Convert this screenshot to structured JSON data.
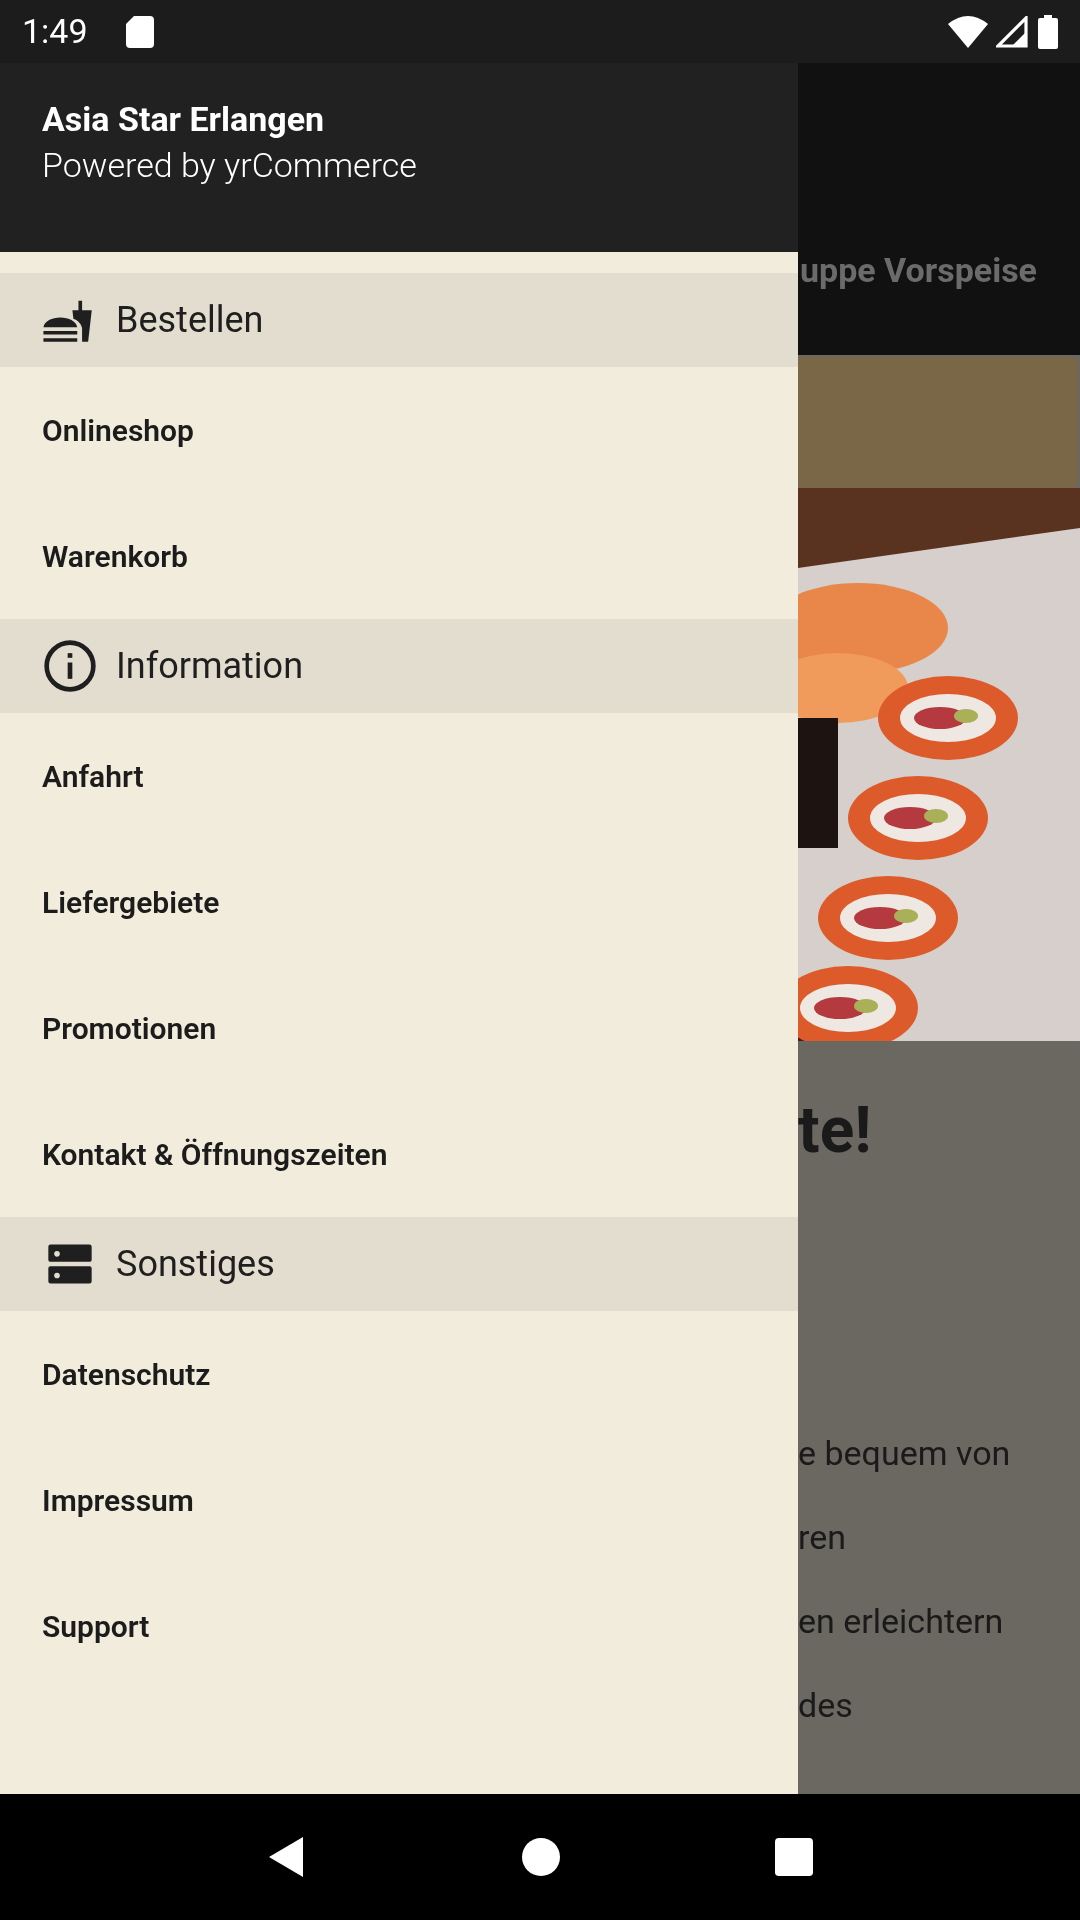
{
  "status_bar": {
    "time": "1:49"
  },
  "drawer": {
    "title": "Asia Star Erlangen",
    "subtitle": "Powered by yrCommerce",
    "sections": [
      {
        "label": "Bestellen",
        "items": [
          "Onlineshop",
          "Warenkorb"
        ]
      },
      {
        "label": "Information",
        "items": [
          "Anfahrt",
          "Liefergebiete",
          "Promotionen",
          "Kontakt & Öffnungszeiten"
        ]
      },
      {
        "label": "Sonstiges",
        "items": [
          "Datenschutz",
          "Impressum",
          "Support"
        ]
      }
    ]
  },
  "background_page": {
    "toolbar_text": "uppe Vorspeise",
    "heading": "te!",
    "body_lines": [
      "e bequem von",
      "ren",
      "en erleichtern",
      "des"
    ]
  }
}
